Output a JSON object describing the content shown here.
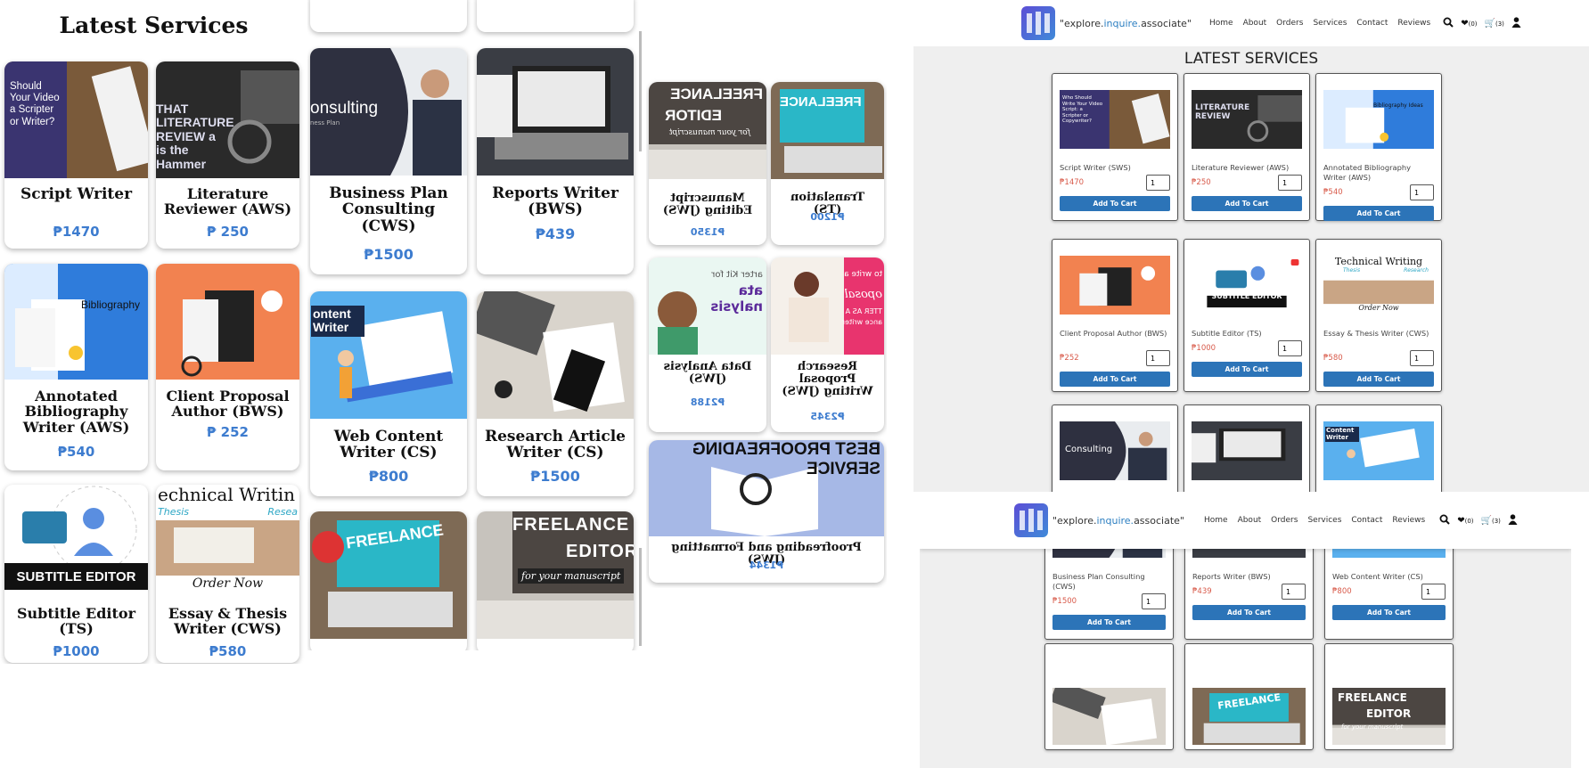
{
  "mobile_a": {
    "heading": "Latest Services",
    "cards": [
      {
        "title": "Script Writer",
        "price": "₱1470",
        "img": "script"
      },
      {
        "title": "Literature Reviewer (AWS)",
        "price": "₱ 250",
        "img": "literature"
      },
      {
        "title": "Annotated Bibliography Writer (AWS)",
        "price": "₱540",
        "img": "bibliography"
      },
      {
        "title": "Client Proposal Author (BWS)",
        "price": "₱ 252",
        "img": "proposal"
      },
      {
        "title": "Subtitle Editor (TS)",
        "price": "₱1000",
        "img": "subtitle"
      },
      {
        "title": "Essay & Thesis Writer (CWS)",
        "price": "₱580",
        "img": "technical"
      }
    ],
    "image_text": {
      "script": "Should Your Video a Scripter or Writer?",
      "literature": "THAT LITERATURE REVIEW a is the Hammer",
      "bibliography": "Bibliography",
      "subtitle": "SUBTITLE EDITOR",
      "technical": "echnical Writin",
      "technical_sub1": "Thesis",
      "technical_sub2": "Resea",
      "technical_order": "Order Now"
    }
  },
  "mobile_b": {
    "cards": [
      {
        "title": "Business Plan Consulting (CWS)",
        "price": "₱1500",
        "img": "consulting"
      },
      {
        "title": "Reports Writer (BWS)",
        "price": "₱439",
        "img": "reports"
      },
      {
        "title": "Web Content Writer (CS)",
        "price": "₱800",
        "img": "webcontent"
      },
      {
        "title": "Research Article Writer (CS)",
        "price": "₱1500",
        "img": "research"
      },
      {
        "title": "",
        "price": "",
        "img": "freelance"
      },
      {
        "title": "",
        "price": "",
        "img": "editor"
      }
    ],
    "image_text": {
      "consulting": "onsulting",
      "consulting_sub": "ness Plan",
      "webcontent": "ontent Writer",
      "freelance": "FREELANCE",
      "editor1": "FREELANCE",
      "editor2": "EDITOR",
      "editor3": "for your manuscript"
    }
  },
  "mobile_c": {
    "cards": [
      {
        "title": "Manuscript Editing (JWS)",
        "price": "₱1350",
        "img": "editor"
      },
      {
        "title": "Translation (TS)",
        "price": "₱1200",
        "img": "freelance"
      },
      {
        "title": "Data Analysis (JWS)",
        "price": "₱2188",
        "img": "data"
      },
      {
        "title": "Research Proposal Writing (JWS)",
        "price": "₱2345",
        "img": "proposalw"
      },
      {
        "title": "Proofreading and Formatting (JWS)",
        "price": "₱1344",
        "img": "proofreading"
      }
    ],
    "image_text": {
      "editor1": "FREELANCE",
      "editor2": "EDITOR",
      "editor3": "for your manuscript",
      "freelance": "FREELANCE",
      "data1": "arter Kit for",
      "data2": "ata",
      "data3": "nalysis",
      "proposal1": "to write a",
      "proposal2": "oposal",
      "proposal3": "TTER AS A",
      "proposal4": "ance writer",
      "proof1": "BEST PROOFREADING",
      "proof2": "SERVICE"
    }
  },
  "desktop": {
    "brand_pre": "\"explore.",
    "brand_accent": "inquire.",
    "brand_post": "associate\"",
    "nav": [
      "Home",
      "About",
      "Orders",
      "Services",
      "Contact",
      "Reviews"
    ],
    "wish_count": "(0)",
    "cart_count": "(3)",
    "heading": "LATEST SERVICES",
    "add_label": "Add To Cart",
    "qty": "1",
    "cards": [
      {
        "name": "Script Writer (SWS)",
        "price": "₱1470",
        "img": "script"
      },
      {
        "name": "Literature Reviewer (AWS)",
        "price": "₱250",
        "img": "literature"
      },
      {
        "name": "Annotated Bibliography Writer (AWS)",
        "price": "₱540",
        "img": "bibliography"
      },
      {
        "name": "Client Proposal Author (BWS)",
        "price": "₱252",
        "img": "proposal"
      },
      {
        "name": "Subtitle Editor (TS)",
        "price": "₱1000",
        "img": "subtitle"
      },
      {
        "name": "Essay & Thesis Writer (CWS)",
        "price": "₱580",
        "img": "technical"
      },
      {
        "name": "Business Plan Consulting",
        "img": "consulting"
      },
      {
        "name": "Reports Writer (BWS)",
        "img": "reports"
      },
      {
        "name": "Web Content Writer (CS)",
        "img": "webcontent"
      }
    ],
    "image_text": {
      "script": "Who Should Write Your Video Script: a Scripter or Copywriter?",
      "literature": "LITERATURE REVIEW",
      "bibliography": "Bibliography Ideas",
      "subtitle": "SUBTITLE EDITOR",
      "technical": "Technical Writing",
      "technical_sub1": "Thesis",
      "technical_sub2": "Research",
      "technical_order": "Order Now",
      "consulting": "Consulting",
      "webcontent": "Content Writer"
    }
  },
  "desktop2": {
    "cards": [
      {
        "name": "Business Plan Consulting (CWS)",
        "price": "₱1500",
        "img": "consulting"
      },
      {
        "name": "Reports Writer (BWS)",
        "price": "₱439",
        "img": "reports"
      },
      {
        "name": "Web Content Writer (CS)",
        "price": "₱800",
        "img": "webcontent"
      },
      {
        "img": "research"
      },
      {
        "img": "freelance"
      },
      {
        "img": "editor"
      }
    ],
    "image_text": {
      "consulting": "Consulting",
      "webcontent": "Writer",
      "freelance": "FREELANCE",
      "editor1": "FREELANCE",
      "editor2": "EDITOR",
      "editor3": "for your manuscript"
    }
  },
  "colors": {
    "accent": "#2c74b8",
    "price_desktop": "#d85a4a",
    "price_mobile": "#3d7ccf",
    "panel": "#efefef"
  }
}
